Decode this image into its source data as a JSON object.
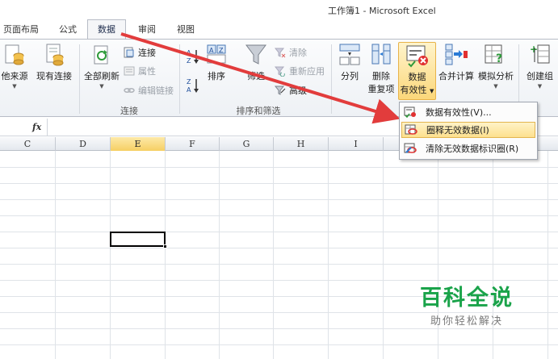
{
  "window": {
    "title": "工作簿1 - Microsoft Excel"
  },
  "tabs": [
    {
      "label": "页面布局"
    },
    {
      "label": "公式"
    },
    {
      "label": "数据"
    },
    {
      "label": "审阅"
    },
    {
      "label": "视图"
    }
  ],
  "ribbon": {
    "get_external": {
      "other_sources": "他来源",
      "existing_conn": "现有连接"
    },
    "connections": {
      "refresh_all": "全部刷新",
      "connect": "连接",
      "properties": "属性",
      "edit_links": "编辑链接",
      "group_label": "连接"
    },
    "sort_filter": {
      "sort": "排序",
      "filter": "筛选",
      "clear": "清除",
      "reapply": "重新应用",
      "advanced": "高级",
      "group_label": "排序和筛选"
    },
    "data_tools": {
      "text_to_columns": "分列",
      "remove_dup_line1": "删除",
      "remove_dup_line2": "重复项",
      "validation_line1": "数据",
      "validation_line2": "有效性",
      "consolidate": "合并计算",
      "what_if": "模拟分析"
    },
    "outline": {
      "group": "创建组"
    }
  },
  "formula_bar": {
    "fx": "fx",
    "value": ""
  },
  "columns": [
    "C",
    "D",
    "E",
    "F",
    "G",
    "H",
    "I"
  ],
  "selected_column": "E",
  "validation_menu": {
    "items": [
      {
        "label": "数据有效性(V)..."
      },
      {
        "label": "圈释无效数据(I)"
      },
      {
        "label": "清除无效数据标识圈(R)"
      }
    ]
  },
  "watermark": {
    "title": "百科全说",
    "subtitle": "助你轻松解决"
  },
  "colors": {
    "accent_arrow": "#e23c3c",
    "watermark_green": "#1aa34a",
    "hover": "#fde08e"
  }
}
